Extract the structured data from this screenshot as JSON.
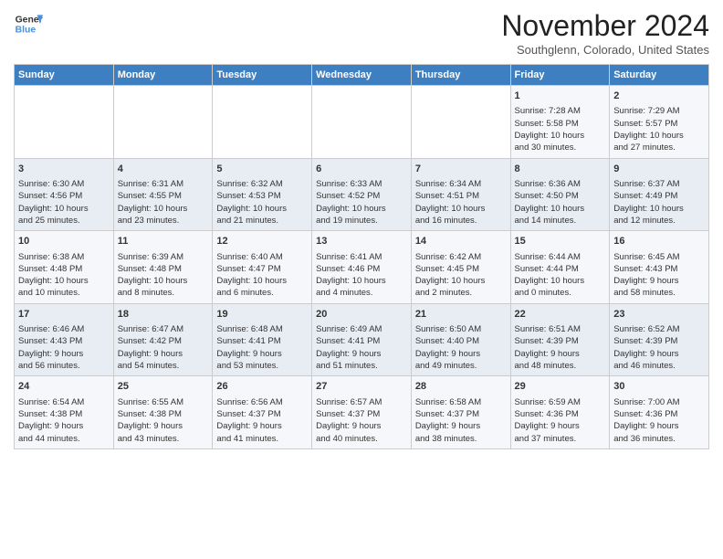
{
  "header": {
    "logo_line1": "General",
    "logo_line2": "Blue",
    "month": "November 2024",
    "location": "Southglenn, Colorado, United States"
  },
  "days_of_week": [
    "Sunday",
    "Monday",
    "Tuesday",
    "Wednesday",
    "Thursday",
    "Friday",
    "Saturday"
  ],
  "weeks": [
    [
      {
        "day": "",
        "info": ""
      },
      {
        "day": "",
        "info": ""
      },
      {
        "day": "",
        "info": ""
      },
      {
        "day": "",
        "info": ""
      },
      {
        "day": "",
        "info": ""
      },
      {
        "day": "1",
        "info": "Sunrise: 7:28 AM\nSunset: 5:58 PM\nDaylight: 10 hours\nand 30 minutes."
      },
      {
        "day": "2",
        "info": "Sunrise: 7:29 AM\nSunset: 5:57 PM\nDaylight: 10 hours\nand 27 minutes."
      }
    ],
    [
      {
        "day": "3",
        "info": "Sunrise: 6:30 AM\nSunset: 4:56 PM\nDaylight: 10 hours\nand 25 minutes."
      },
      {
        "day": "4",
        "info": "Sunrise: 6:31 AM\nSunset: 4:55 PM\nDaylight: 10 hours\nand 23 minutes."
      },
      {
        "day": "5",
        "info": "Sunrise: 6:32 AM\nSunset: 4:53 PM\nDaylight: 10 hours\nand 21 minutes."
      },
      {
        "day": "6",
        "info": "Sunrise: 6:33 AM\nSunset: 4:52 PM\nDaylight: 10 hours\nand 19 minutes."
      },
      {
        "day": "7",
        "info": "Sunrise: 6:34 AM\nSunset: 4:51 PM\nDaylight: 10 hours\nand 16 minutes."
      },
      {
        "day": "8",
        "info": "Sunrise: 6:36 AM\nSunset: 4:50 PM\nDaylight: 10 hours\nand 14 minutes."
      },
      {
        "day": "9",
        "info": "Sunrise: 6:37 AM\nSunset: 4:49 PM\nDaylight: 10 hours\nand 12 minutes."
      }
    ],
    [
      {
        "day": "10",
        "info": "Sunrise: 6:38 AM\nSunset: 4:48 PM\nDaylight: 10 hours\nand 10 minutes."
      },
      {
        "day": "11",
        "info": "Sunrise: 6:39 AM\nSunset: 4:48 PM\nDaylight: 10 hours\nand 8 minutes."
      },
      {
        "day": "12",
        "info": "Sunrise: 6:40 AM\nSunset: 4:47 PM\nDaylight: 10 hours\nand 6 minutes."
      },
      {
        "day": "13",
        "info": "Sunrise: 6:41 AM\nSunset: 4:46 PM\nDaylight: 10 hours\nand 4 minutes."
      },
      {
        "day": "14",
        "info": "Sunrise: 6:42 AM\nSunset: 4:45 PM\nDaylight: 10 hours\nand 2 minutes."
      },
      {
        "day": "15",
        "info": "Sunrise: 6:44 AM\nSunset: 4:44 PM\nDaylight: 10 hours\nand 0 minutes."
      },
      {
        "day": "16",
        "info": "Sunrise: 6:45 AM\nSunset: 4:43 PM\nDaylight: 9 hours\nand 58 minutes."
      }
    ],
    [
      {
        "day": "17",
        "info": "Sunrise: 6:46 AM\nSunset: 4:43 PM\nDaylight: 9 hours\nand 56 minutes."
      },
      {
        "day": "18",
        "info": "Sunrise: 6:47 AM\nSunset: 4:42 PM\nDaylight: 9 hours\nand 54 minutes."
      },
      {
        "day": "19",
        "info": "Sunrise: 6:48 AM\nSunset: 4:41 PM\nDaylight: 9 hours\nand 53 minutes."
      },
      {
        "day": "20",
        "info": "Sunrise: 6:49 AM\nSunset: 4:41 PM\nDaylight: 9 hours\nand 51 minutes."
      },
      {
        "day": "21",
        "info": "Sunrise: 6:50 AM\nSunset: 4:40 PM\nDaylight: 9 hours\nand 49 minutes."
      },
      {
        "day": "22",
        "info": "Sunrise: 6:51 AM\nSunset: 4:39 PM\nDaylight: 9 hours\nand 48 minutes."
      },
      {
        "day": "23",
        "info": "Sunrise: 6:52 AM\nSunset: 4:39 PM\nDaylight: 9 hours\nand 46 minutes."
      }
    ],
    [
      {
        "day": "24",
        "info": "Sunrise: 6:54 AM\nSunset: 4:38 PM\nDaylight: 9 hours\nand 44 minutes."
      },
      {
        "day": "25",
        "info": "Sunrise: 6:55 AM\nSunset: 4:38 PM\nDaylight: 9 hours\nand 43 minutes."
      },
      {
        "day": "26",
        "info": "Sunrise: 6:56 AM\nSunset: 4:37 PM\nDaylight: 9 hours\nand 41 minutes."
      },
      {
        "day": "27",
        "info": "Sunrise: 6:57 AM\nSunset: 4:37 PM\nDaylight: 9 hours\nand 40 minutes."
      },
      {
        "day": "28",
        "info": "Sunrise: 6:58 AM\nSunset: 4:37 PM\nDaylight: 9 hours\nand 38 minutes."
      },
      {
        "day": "29",
        "info": "Sunrise: 6:59 AM\nSunset: 4:36 PM\nDaylight: 9 hours\nand 37 minutes."
      },
      {
        "day": "30",
        "info": "Sunrise: 7:00 AM\nSunset: 4:36 PM\nDaylight: 9 hours\nand 36 minutes."
      }
    ]
  ]
}
